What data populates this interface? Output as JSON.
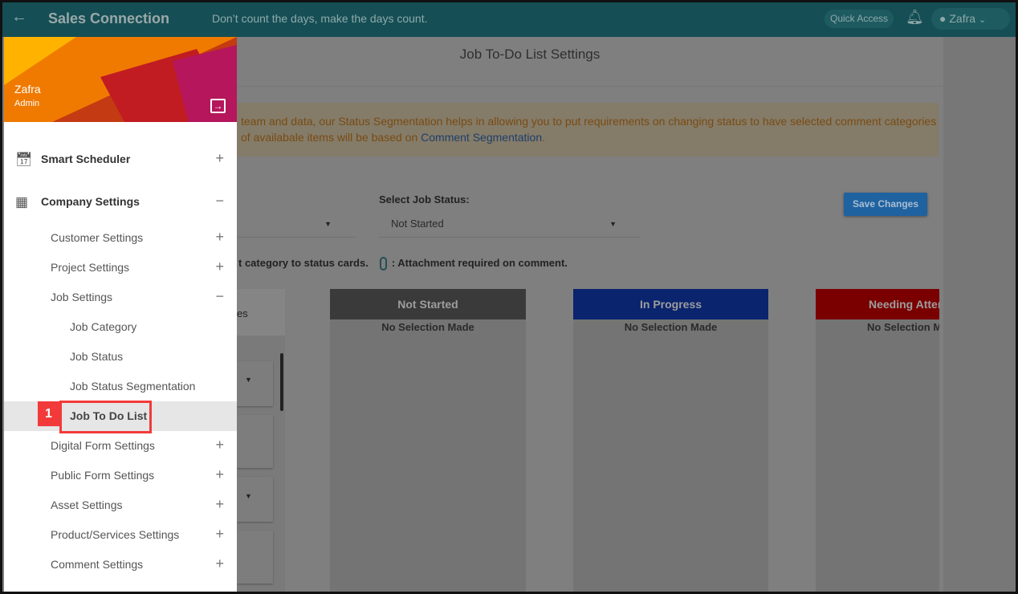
{
  "header": {
    "back_icon": "arrow-left-icon",
    "brand": "Sales Connection",
    "tagline": "Don’t count the days, make the days count.",
    "quick_access": "Quick Access",
    "bell_icon": "bell-icon",
    "user": "Zafra"
  },
  "page": {
    "title": "Job To-Do List Settings",
    "banner_line1": "team and data, our Status Segmentation helps in allowing you to put requirements on changing status to have selected comment categories",
    "banner_line2_prefix": "of availabale items will be based on ",
    "banner_link": "Comment Segmentation",
    "banner_line2_suffix": ".",
    "select_job_status_label": "Select Job Status:",
    "select_job_status_value": "Not Started",
    "save_label": "Save Changes",
    "legend_left": "t category to status cards.",
    "legend_attachment": ": Attachment required on comment.",
    "left_column_header": "es",
    "columns": [
      {
        "title": "Not Started",
        "body": "No Selection Made",
        "color": "#3a3a3a"
      },
      {
        "title": "In Progress",
        "body": "No Selection Made",
        "color": "#0a246e"
      },
      {
        "title": "Needing Atten",
        "body": "No Selection M",
        "color": "#7a0000"
      }
    ]
  },
  "sidebar": {
    "user_name": "Zafra",
    "user_role": "Admin",
    "items": [
      {
        "label": "Smart Scheduler",
        "toggle": "+"
      },
      {
        "label": "Company Settings",
        "toggle": "−"
      },
      {
        "label": "Customer Settings",
        "toggle": "+"
      },
      {
        "label": "Project Settings",
        "toggle": "+"
      },
      {
        "label": "Job Settings",
        "toggle": "−"
      },
      {
        "label": "Job Category"
      },
      {
        "label": "Job Status"
      },
      {
        "label": "Job Status Segmentation"
      },
      {
        "label": "Job To Do List"
      },
      {
        "label": "Digital Form Settings",
        "toggle": "+"
      },
      {
        "label": "Public Form Settings",
        "toggle": "+"
      },
      {
        "label": "Asset Settings",
        "toggle": "+"
      },
      {
        "label": "Product/Services Settings",
        "toggle": "+"
      },
      {
        "label": "Comment Settings",
        "toggle": "+"
      }
    ]
  },
  "annotation": {
    "step": "1"
  }
}
